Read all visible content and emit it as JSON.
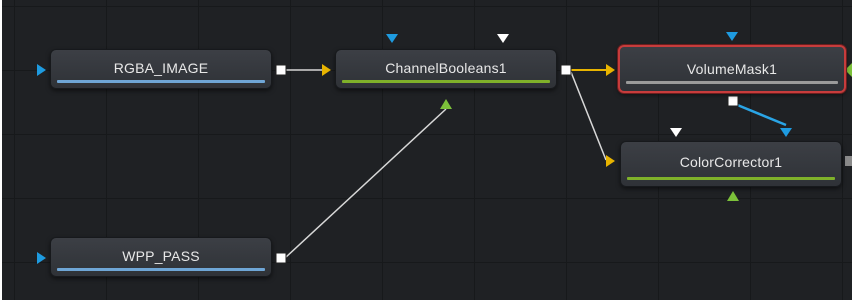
{
  "flow": {
    "nodes": [
      {
        "id": "rgba",
        "label": "RGBA_IMAGE",
        "bar_color": "#6fa6d6"
      },
      {
        "id": "cb",
        "label": "ChannelBooleans1",
        "bar_color": "#7fb12a"
      },
      {
        "id": "vm",
        "label": "VolumeMask1",
        "bar_color": "#9a9a9a",
        "selected": true
      },
      {
        "id": "cc",
        "label": "ColorCorrector1",
        "bar_color": "#7fb12a"
      },
      {
        "id": "wpp",
        "label": "WPP_PASS",
        "bar_color": "#6fa6d6"
      }
    ]
  },
  "colors": {
    "background": "#1f2124",
    "input_blue": "#1e9be0",
    "input_yellow": "#e8b400",
    "input_green": "#7cc13a",
    "input_white": "#ffffff",
    "link_line": "#d8d8d8",
    "link_yellow": "#e8b400",
    "link_blue": "#2aa5e6",
    "selection_red": "#c73c3c"
  }
}
